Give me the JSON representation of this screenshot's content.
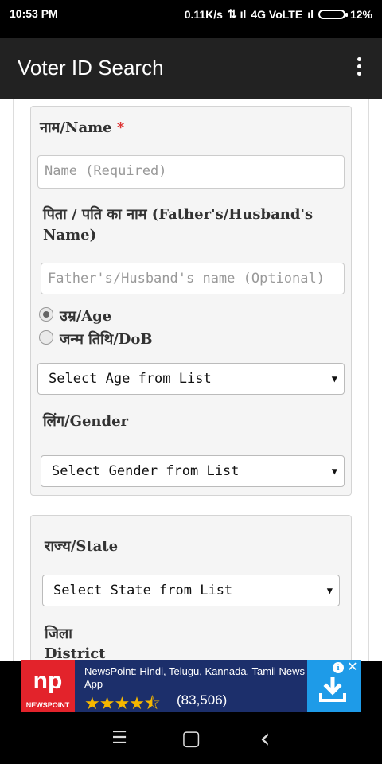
{
  "status": {
    "time": "10:53 PM",
    "speed": "0.11K/s",
    "network": "4G VoLTE",
    "battery": "12%"
  },
  "appbar": {
    "title": "Voter ID Search"
  },
  "form": {
    "name_label": "नाम/Name",
    "required_mark": "*",
    "name_placeholder": "Name (Required)",
    "father_label": "पिता / पति का नाम (Father's/Husband's Name)",
    "father_placeholder": "Father's/Husband's name (Optional)",
    "age_option": "उम्र/Age",
    "dob_option": "जन्म तिथि/DoB",
    "age_select": "Select Age from List",
    "gender_label": "लिंग/Gender",
    "gender_select": "Select Gender from List",
    "state_label": "राज्य/State",
    "state_select": "Select State from List",
    "district_label_hi": "जिला",
    "district_label_en": "District",
    "selected_option": "age"
  },
  "ad": {
    "brand": "NEWSPOINT",
    "logo_text": "np",
    "headline": "NewsPoint: Hindi, Telugu, Kannada, Tamil News App",
    "rating_stars": 4.5,
    "stars_glyphs": "★★★★⯪",
    "rating_count": "(83,506)"
  },
  "navbar": {
    "menu_glyph": "☰",
    "home_glyph": "▢",
    "back_glyph": "‹"
  },
  "colors": {
    "appbar": "#222222",
    "required": "#dd3333",
    "ad_bg": "#1c2f6b",
    "ad_logo": "#e3232b",
    "ad_download": "#1e9be8",
    "star": "#f5b700"
  }
}
